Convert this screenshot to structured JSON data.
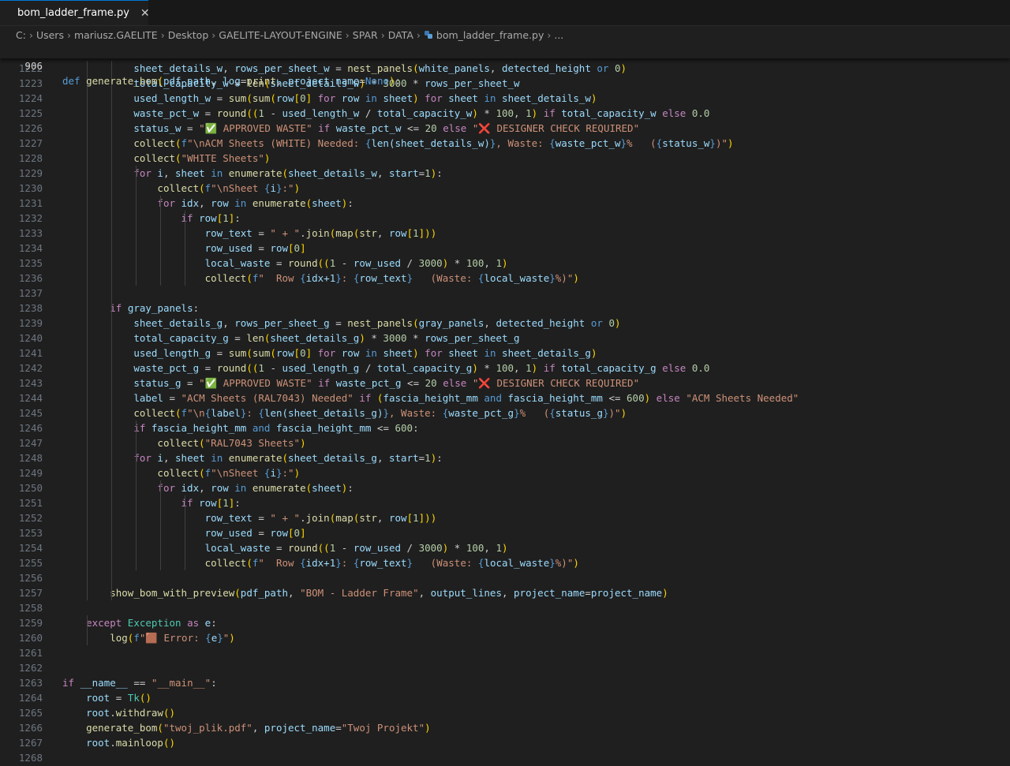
{
  "tab": {
    "title": "bom_ladder_frame.py",
    "close": "✕"
  },
  "breadcrumb": {
    "parts": [
      "C:",
      "Users",
      "mariusz.GAELITE",
      "Desktop",
      "GAELITE-LAYOUT-ENGINE",
      "SPAR",
      "DATA"
    ],
    "file": "bom_ladder_frame.py",
    "ellipsis": "..."
  },
  "sticky": {
    "num": "906",
    "text": "def generate_bom(pdf_path, log=print, project_name=None):"
  },
  "lines": [
    {
      "num": "1222",
      "text": "            sheet_details_w, rows_per_sheet_w = nest_panels(white_panels, detected_height or 0)"
    },
    {
      "num": "1223",
      "text": "            total_capacity_w = len(sheet_details_w) * 3000 * rows_per_sheet_w"
    },
    {
      "num": "1224",
      "text": "            used_length_w = sum(sum(row[0] for row in sheet) for sheet in sheet_details_w)"
    },
    {
      "num": "1225",
      "text": "            waste_pct_w = round((1 - used_length_w / total_capacity_w) * 100, 1) if total_capacity_w else 0.0"
    },
    {
      "num": "1226",
      "text": "            status_w = \"✅ APPROVED WASTE\" if waste_pct_w <= 20 else \"❌ DESIGNER CHECK REQUIRED\""
    },
    {
      "num": "1227",
      "text": "            collect(f\"\\nACM Sheets (WHITE) Needed: {len(sheet_details_w)}, Waste: {waste_pct_w}%   ({status_w})\")"
    },
    {
      "num": "1228",
      "text": "            collect(\"WHITE Sheets\")"
    },
    {
      "num": "1229",
      "text": "            for i, sheet in enumerate(sheet_details_w, start=1):"
    },
    {
      "num": "1230",
      "text": "                collect(f\"\\nSheet {i}:\")"
    },
    {
      "num": "1231",
      "text": "                for idx, row in enumerate(sheet):"
    },
    {
      "num": "1232",
      "text": "                    if row[1]:"
    },
    {
      "num": "1233",
      "text": "                        row_text = \" + \".join(map(str, row[1]))"
    },
    {
      "num": "1234",
      "text": "                        row_used = row[0]"
    },
    {
      "num": "1235",
      "text": "                        local_waste = round((1 - row_used / 3000) * 100, 1)"
    },
    {
      "num": "1236",
      "text": "                        collect(f\"  Row {idx+1}: {row_text}   (Waste: {local_waste}%)\")"
    },
    {
      "num": "1237",
      "text": ""
    },
    {
      "num": "1238",
      "text": "        if gray_panels:"
    },
    {
      "num": "1239",
      "text": "            sheet_details_g, rows_per_sheet_g = nest_panels(gray_panels, detected_height or 0)"
    },
    {
      "num": "1240",
      "text": "            total_capacity_g = len(sheet_details_g) * 3000 * rows_per_sheet_g"
    },
    {
      "num": "1241",
      "text": "            used_length_g = sum(sum(row[0] for row in sheet) for sheet in sheet_details_g)"
    },
    {
      "num": "1242",
      "text": "            waste_pct_g = round((1 - used_length_g / total_capacity_g) * 100, 1) if total_capacity_g else 0.0"
    },
    {
      "num": "1243",
      "text": "            status_g = \"✅ APPROVED WASTE\" if waste_pct_g <= 20 else \"❌ DESIGNER CHECK REQUIRED\""
    },
    {
      "num": "1244",
      "text": "            label = \"ACM Sheets (RAL7043) Needed\" if (fascia_height_mm and fascia_height_mm <= 600) else \"ACM Sheets Needed\""
    },
    {
      "num": "1245",
      "text": "            collect(f\"\\n{label}: {len(sheet_details_g)}, Waste: {waste_pct_g}%   ({status_g})\")"
    },
    {
      "num": "1246",
      "text": "            if fascia_height_mm and fascia_height_mm <= 600:"
    },
    {
      "num": "1247",
      "text": "                collect(\"RAL7043 Sheets\")"
    },
    {
      "num": "1248",
      "text": "            for i, sheet in enumerate(sheet_details_g, start=1):"
    },
    {
      "num": "1249",
      "text": "                collect(f\"\\nSheet {i}:\")"
    },
    {
      "num": "1250",
      "text": "                for idx, row in enumerate(sheet):"
    },
    {
      "num": "1251",
      "text": "                    if row[1]:"
    },
    {
      "num": "1252",
      "text": "                        row_text = \" + \".join(map(str, row[1]))"
    },
    {
      "num": "1253",
      "text": "                        row_used = row[0]"
    },
    {
      "num": "1254",
      "text": "                        local_waste = round((1 - row_used / 3000) * 100, 1)"
    },
    {
      "num": "1255",
      "text": "                        collect(f\"  Row {idx+1}: {row_text}   (Waste: {local_waste}%)\")"
    },
    {
      "num": "1256",
      "text": ""
    },
    {
      "num": "1257",
      "text": "        show_bom_with_preview(pdf_path, \"BOM - Ladder Frame\", output_lines, project_name=project_name)"
    },
    {
      "num": "1258",
      "text": ""
    },
    {
      "num": "1259",
      "text": "    except Exception as e:"
    },
    {
      "num": "1260",
      "text": "        log(f\"🟫 Error: {e}\")"
    },
    {
      "num": "1261",
      "text": ""
    },
    {
      "num": "1262",
      "text": ""
    },
    {
      "num": "1263",
      "text": "if __name__ == \"__main__\":"
    },
    {
      "num": "1264",
      "text": "    root = Tk()"
    },
    {
      "num": "1265",
      "text": "    root.withdraw()"
    },
    {
      "num": "1266",
      "text": "    generate_bom(\"twoj_plik.pdf\", project_name=\"Twoj Projekt\")"
    },
    {
      "num": "1267",
      "text": "    root.mainloop()"
    },
    {
      "num": "1268",
      "text": ""
    }
  ]
}
